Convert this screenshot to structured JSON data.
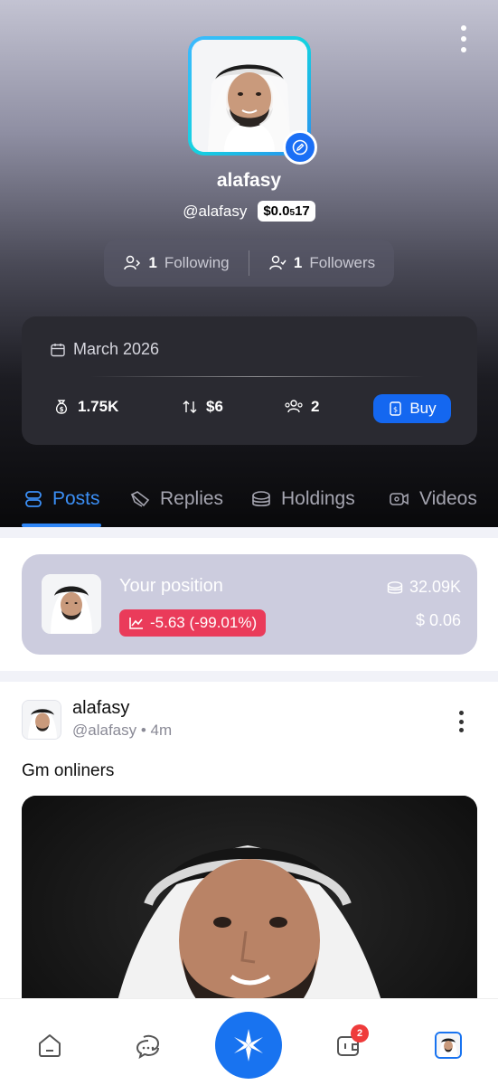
{
  "profile": {
    "name": "alafasy",
    "handle": "@alafasy",
    "price_main": "$0.0",
    "price_sub": "5",
    "price_tail": "17",
    "following_count": "1",
    "following_label": "Following",
    "followers_count": "1",
    "followers_label": "Followers"
  },
  "stats": {
    "date": "March 2026",
    "market_cap": "1.75K",
    "volume": "$6",
    "holders": "2",
    "buy_label": "Buy"
  },
  "tabs": [
    {
      "label": "Posts",
      "icon": "posts-icon",
      "active": true
    },
    {
      "label": "Replies",
      "icon": "replies-icon",
      "active": false
    },
    {
      "label": "Holdings",
      "icon": "coins-icon",
      "active": false
    },
    {
      "label": "Videos",
      "icon": "video-icon",
      "active": false
    }
  ],
  "position": {
    "title": "Your position",
    "pnl": "-5.63 (-99.01%)",
    "holdings": "32.09K",
    "value": "$ 0.06"
  },
  "post": {
    "author": "alafasy",
    "meta": "@alafasy • 4m",
    "text": "Gm onliners"
  },
  "bottom_nav": {
    "notification_count": "2",
    "items": [
      "home-icon",
      "chat-icon",
      "create-icon",
      "wallet-icon",
      "profile-avatar"
    ]
  },
  "colors": {
    "accent": "#1873f0",
    "negative": "#ea3b5a",
    "tab_active": "#3b8ff6"
  }
}
